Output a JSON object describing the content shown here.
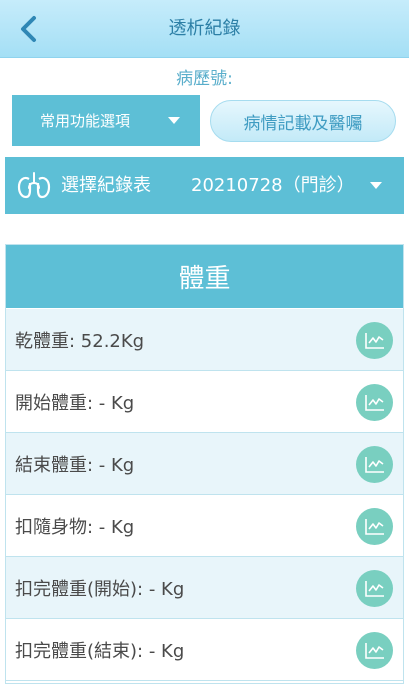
{
  "header": {
    "title": "透析紀錄"
  },
  "record_label": "病歷號:",
  "function_select": {
    "label": "常用功能選項"
  },
  "notes_button": {
    "label": "病情記載及醫囑"
  },
  "record_table_select": {
    "label": "選擇紀錄表",
    "value": "20210728（門診）"
  },
  "panel": {
    "title": "體重",
    "rows": [
      {
        "label": "乾體重: 52.2Kg"
      },
      {
        "label": "開始體重: - Kg"
      },
      {
        "label": "結束體重: - Kg"
      },
      {
        "label": "扣隨身物: - Kg"
      },
      {
        "label": "扣完體重(開始): - Kg"
      },
      {
        "label": "扣完體重(結束): - Kg"
      }
    ]
  },
  "colors": {
    "accent": "#5dbfd6",
    "header_bg": "#a4dff5",
    "chart_icon_bg": "#79cfc0",
    "row_alt_bg": "#e8f5fa"
  },
  "icons": {
    "back": "chevron-left-icon",
    "record_table": "lungs-icon",
    "row_action": "line-chart-icon",
    "dropdown": "caret-down-icon"
  }
}
